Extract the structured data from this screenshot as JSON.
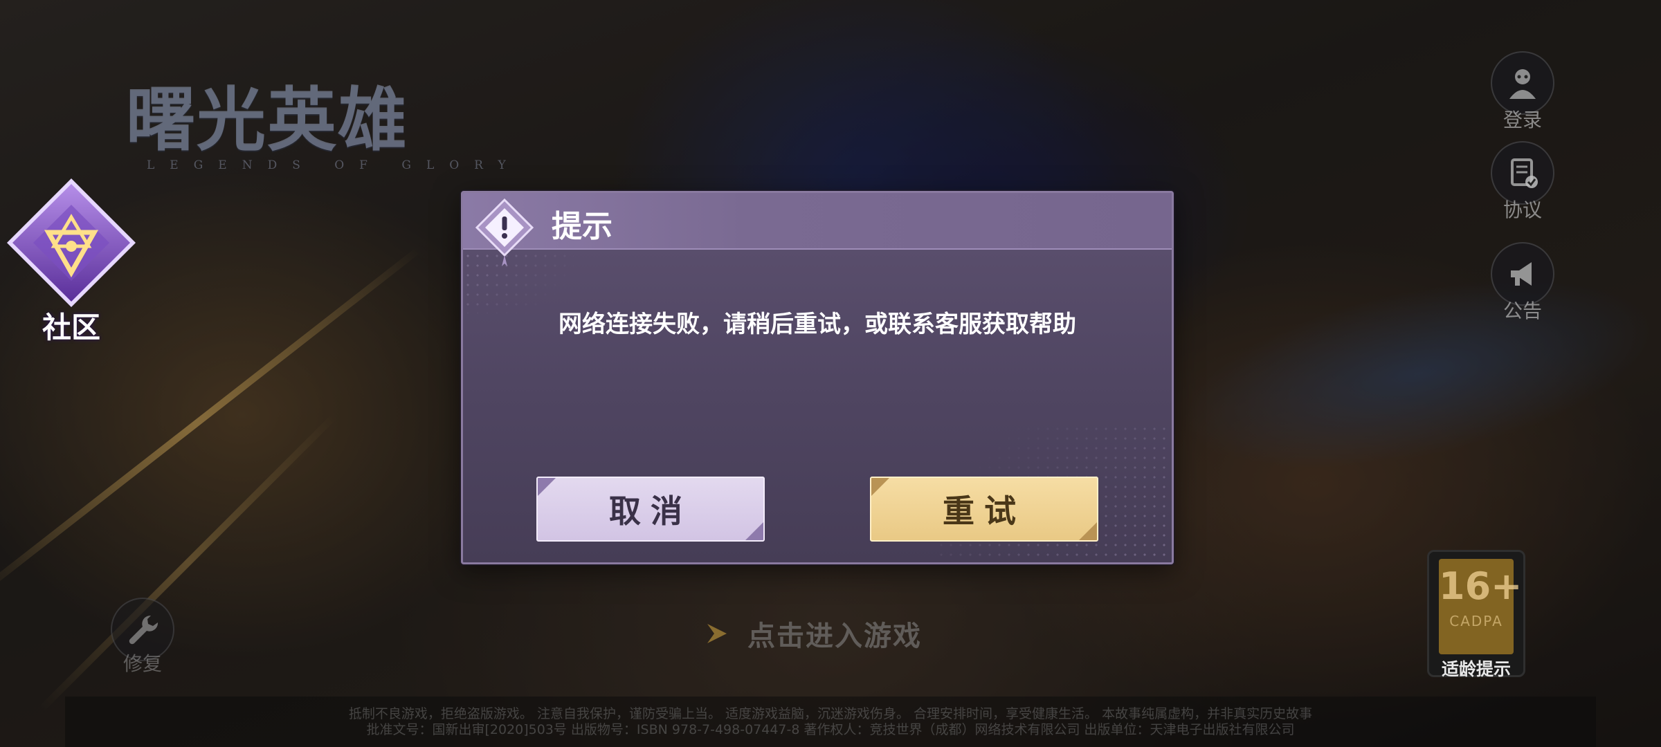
{
  "logo": {
    "title": "曙光英雄",
    "subtitle": "LEGENDS OF GLORY"
  },
  "community": {
    "label": "社区",
    "icon": "community-emblem-icon"
  },
  "side_buttons": [
    {
      "label": "登录",
      "icon": "user-icon"
    },
    {
      "label": "协议",
      "icon": "document-check-icon"
    },
    {
      "label": "公告",
      "icon": "megaphone-icon"
    }
  ],
  "repair": {
    "label": "修复",
    "icon": "wrench-icon"
  },
  "age_rating": {
    "number": "16+",
    "org": "CADPA",
    "tip": "适龄提示"
  },
  "enter_game": {
    "label": "点击进入游戏"
  },
  "legal": {
    "line1": "抵制不良游戏，拒绝盗版游戏。 注意自我保护，谨防受骗上当。 适度游戏益脑，沉迷游戏伤身。 合理安排时间，享受健康生活。 本故事纯属虚构，并非真实历史故事",
    "line2": "批准文号：国新出审[2020]503号  出版物号：ISBN 978-7-498-07447-8  著作权人：竞技世界（成都）网络技术有限公司  出版单位：天津电子出版社有限公司"
  },
  "dialog": {
    "title": "提示",
    "message": "网络连接失败，请稍后重试，或联系客服获取帮助",
    "cancel_label": "取消",
    "retry_label": "重试"
  },
  "colors": {
    "dialog_bg": "#574b69",
    "dialog_header": "#7a6a92",
    "cancel_btn": "#d9cde9",
    "retry_btn": "#efd293"
  }
}
